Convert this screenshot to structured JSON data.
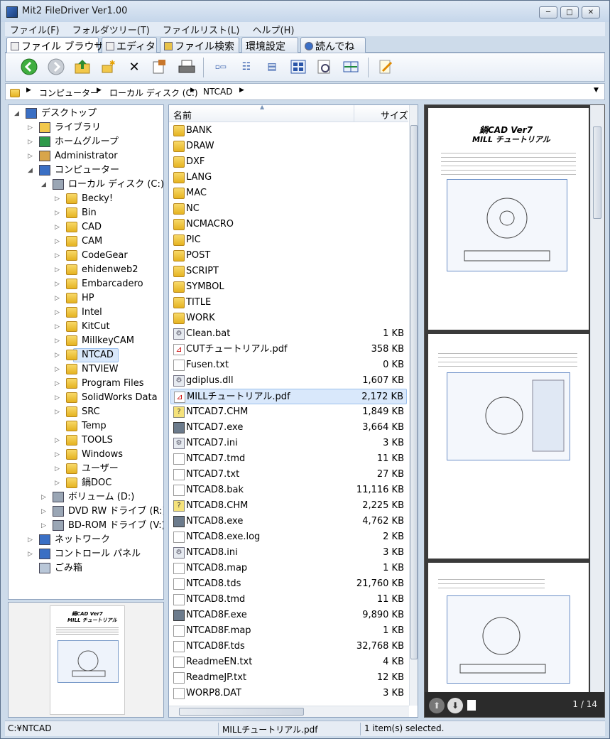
{
  "window": {
    "title": "Mit2 FileDriver Ver1.00",
    "min": "─",
    "max": "□",
    "close": "✕"
  },
  "menu": [
    "ファイル(F)",
    "フォルダツリー(T)",
    "ファイルリスト(L)",
    "ヘルプ(H)"
  ],
  "tabs": [
    "ファイル ブラウザ",
    "エディタ",
    "ファイル検索",
    "環境設定",
    "読んでね"
  ],
  "address": {
    "crumbs": [
      "コンピューター",
      "ローカル ディスク (C:)",
      "NTCAD"
    ]
  },
  "tree": [
    {
      "label": "デスクトップ",
      "exp": "◢"
    },
    {
      "label": "ライブラリ",
      "exp": "▷"
    },
    {
      "label": "ホームグループ",
      "exp": "▷"
    },
    {
      "label": "Administrator",
      "exp": "▷"
    },
    {
      "label": "コンピューター",
      "exp": "◢"
    },
    {
      "label": "ローカル ディスク (C:)",
      "exp": "◢"
    },
    {
      "label": "Becky!",
      "exp": "▷"
    },
    {
      "label": "Bin",
      "exp": "▷"
    },
    {
      "label": "CAD",
      "exp": "▷"
    },
    {
      "label": "CAM",
      "exp": "▷"
    },
    {
      "label": "CodeGear",
      "exp": "▷"
    },
    {
      "label": "ehidenweb2",
      "exp": "▷"
    },
    {
      "label": "Embarcadero",
      "exp": "▷"
    },
    {
      "label": "HP",
      "exp": "▷"
    },
    {
      "label": "Intel",
      "exp": "▷"
    },
    {
      "label": "KitCut",
      "exp": "▷"
    },
    {
      "label": "MillkeyCAM",
      "exp": "▷"
    },
    {
      "label": "NTCAD",
      "exp": "▷"
    },
    {
      "label": "NTVIEW",
      "exp": "▷"
    },
    {
      "label": "Program Files",
      "exp": "▷"
    },
    {
      "label": "SolidWorks Data",
      "exp": "▷"
    },
    {
      "label": "SRC",
      "exp": "▷"
    },
    {
      "label": "Temp",
      "exp": ""
    },
    {
      "label": "TOOLS",
      "exp": "▷"
    },
    {
      "label": "Windows",
      "exp": "▷"
    },
    {
      "label": "ユーザー",
      "exp": "▷"
    },
    {
      "label": "鍋DOC",
      "exp": "▷"
    },
    {
      "label": "ボリューム (D:)",
      "exp": "▷"
    },
    {
      "label": "DVD RW ドライブ (R:)",
      "exp": "▷"
    },
    {
      "label": "BD-ROM ドライブ (V:)",
      "exp": "▷"
    },
    {
      "label": "ネットワーク",
      "exp": "▷"
    },
    {
      "label": "コントロール パネル",
      "exp": "▷"
    },
    {
      "label": "ごみ箱",
      "exp": ""
    }
  ],
  "list": {
    "headers": {
      "name": "名前",
      "size": "サイズ"
    },
    "files": [
      {
        "name": "BANK",
        "size": ""
      },
      {
        "name": "DRAW",
        "size": ""
      },
      {
        "name": "DXF",
        "size": ""
      },
      {
        "name": "LANG",
        "size": ""
      },
      {
        "name": "MAC",
        "size": ""
      },
      {
        "name": "NC",
        "size": ""
      },
      {
        "name": "NCMACRO",
        "size": ""
      },
      {
        "name": "PIC",
        "size": ""
      },
      {
        "name": "POST",
        "size": ""
      },
      {
        "name": "SCRIPT",
        "size": ""
      },
      {
        "name": "SYMBOL",
        "size": ""
      },
      {
        "name": "TITLE",
        "size": ""
      },
      {
        "name": "WORK",
        "size": ""
      },
      {
        "name": "Clean.bat",
        "size": "1 KB"
      },
      {
        "name": "CUTチュートリアル.pdf",
        "size": "358 KB"
      },
      {
        "name": "Fusen.txt",
        "size": "0 KB"
      },
      {
        "name": "gdiplus.dll",
        "size": "1,607 KB"
      },
      {
        "name": "MILLチュートリアル.pdf",
        "size": "2,172 KB"
      },
      {
        "name": "NTCAD7.CHM",
        "size": "1,849 KB"
      },
      {
        "name": "NTCAD7.exe",
        "size": "3,664 KB"
      },
      {
        "name": "NTCAD7.ini",
        "size": "3 KB"
      },
      {
        "name": "NTCAD7.tmd",
        "size": "11 KB"
      },
      {
        "name": "NTCAD7.txt",
        "size": "27 KB"
      },
      {
        "name": "NTCAD8.bak",
        "size": "11,116 KB"
      },
      {
        "name": "NTCAD8.CHM",
        "size": "2,225 KB"
      },
      {
        "name": "NTCAD8.exe",
        "size": "4,762 KB"
      },
      {
        "name": "NTCAD8.exe.log",
        "size": "2 KB"
      },
      {
        "name": "NTCAD8.ini",
        "size": "3 KB"
      },
      {
        "name": "NTCAD8.map",
        "size": "1 KB"
      },
      {
        "name": "NTCAD8.tds",
        "size": "21,760 KB"
      },
      {
        "name": "NTCAD8.tmd",
        "size": "11 KB"
      },
      {
        "name": "NTCAD8F.exe",
        "size": "9,890 KB"
      },
      {
        "name": "NTCAD8F.map",
        "size": "1 KB"
      },
      {
        "name": "NTCAD8F.tds",
        "size": "32,768 KB"
      },
      {
        "name": "ReadmeEN.txt",
        "size": "4 KB"
      },
      {
        "name": "ReadmeJP.txt",
        "size": "12 KB"
      },
      {
        "name": "WORP8.DAT",
        "size": "3 KB"
      }
    ]
  },
  "preview": {
    "page_indicator": "1 / 14",
    "doc_title_1": "鍋CAD Ver7",
    "doc_title_2": "MILL チュートリアル"
  },
  "status": {
    "path": "C:¥NTCAD",
    "file": "MILLチュートリアル.pdf",
    "selection": "1 item(s) selected."
  }
}
